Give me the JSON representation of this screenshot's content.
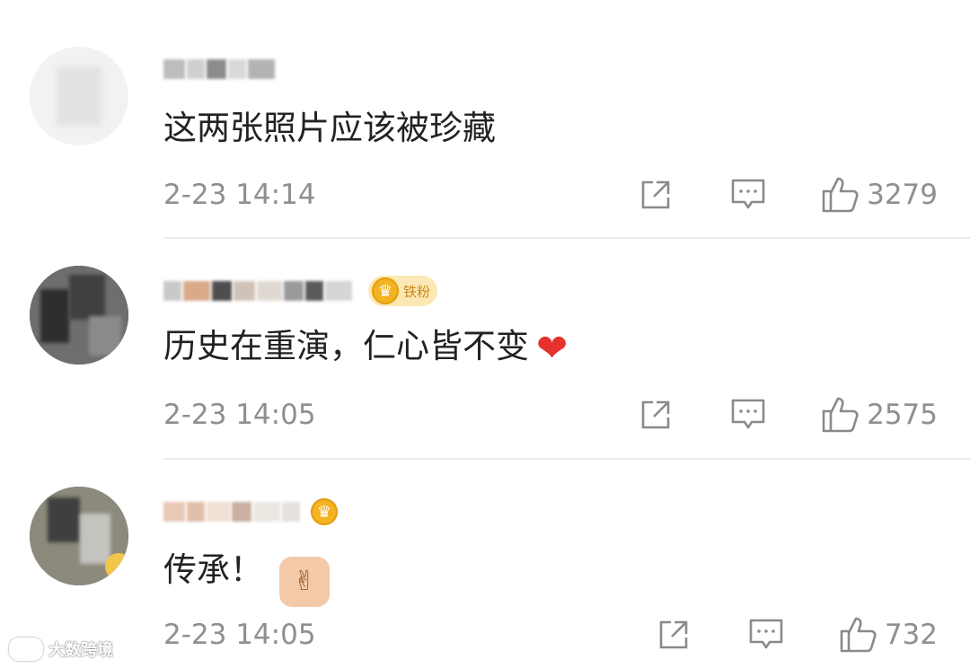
{
  "comments": [
    {
      "content": "这两张照片应该被珍藏",
      "time": "2-23 14:14",
      "likes": "3279",
      "fan_badge": "",
      "has_crown": false,
      "emoji": ""
    },
    {
      "content": "历史在重演，仁心皆不变",
      "time": "2-23 14:05",
      "likes": "2575",
      "fan_badge": "铁粉",
      "has_crown": true,
      "emoji": "heart"
    },
    {
      "content": "传承！",
      "time": "2-23 14:05",
      "likes": "732",
      "fan_badge": "",
      "has_crown": true,
      "emoji": "praying-hands"
    }
  ],
  "icons": {
    "share": "share-icon",
    "comment": "comment-icon",
    "like": "thumbs-up-icon",
    "heart": "heart-emoji",
    "hands": "praying-hands-emoji",
    "crown": "crown-icon"
  },
  "watermark": {
    "text": "大数跨境"
  },
  "colors": {
    "text": "#222222",
    "meta": "#8f8f8f",
    "badge_bg": "#fbe8b4",
    "badge_text": "#c88a1a",
    "crown": "#f4b323",
    "heart": "#e5322d"
  }
}
